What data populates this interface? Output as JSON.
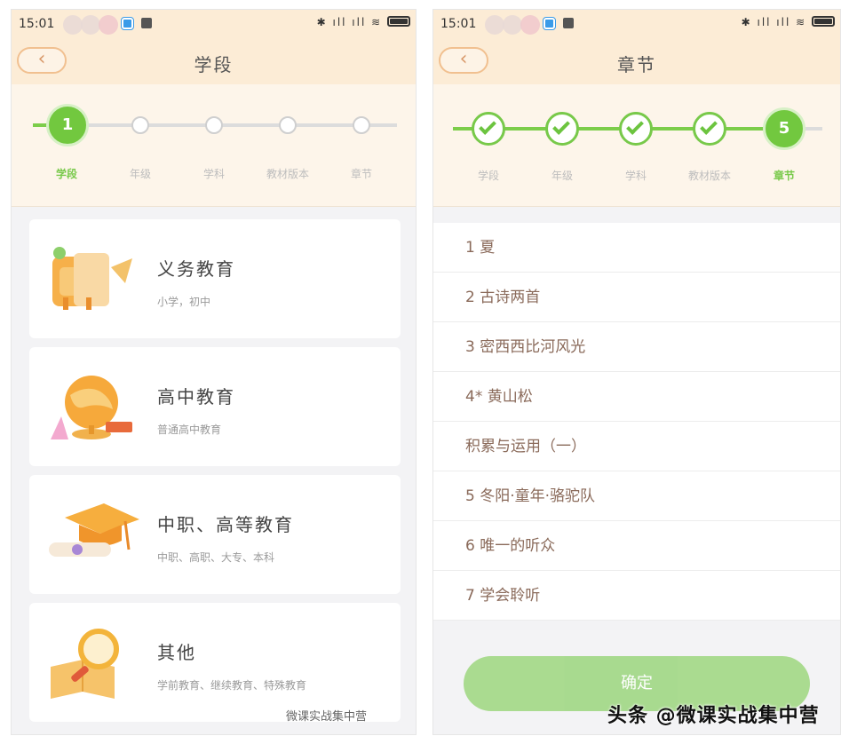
{
  "left_screen": {
    "status_time": "15:01",
    "title": "学段",
    "back_icon": "chevron-left-icon",
    "steps": [
      {
        "label": "学段",
        "number": "1",
        "state": "current"
      },
      {
        "label": "年级",
        "number": "",
        "state": "todo"
      },
      {
        "label": "学科",
        "number": "",
        "state": "todo"
      },
      {
        "label": "教材版本",
        "number": "",
        "state": "todo"
      },
      {
        "label": "章节",
        "number": "",
        "state": "todo"
      }
    ],
    "cards": [
      {
        "title": "义务教育",
        "subtitle": "小学，初中",
        "icon": "schoolbag-icon"
      },
      {
        "title": "高中教育",
        "subtitle": "普通高中教育",
        "icon": "globe-icon"
      },
      {
        "title": "中职、高等教育",
        "subtitle": "中职、高职、大专、本科",
        "icon": "graduation-cap-icon"
      },
      {
        "title": "其他",
        "subtitle": "学前教育、继续教育、特殊教育",
        "icon": "magnifier-book-icon"
      }
    ],
    "watermark": "微课实战集中营"
  },
  "right_screen": {
    "status_time": "15:01",
    "title": "章节",
    "back_icon": "chevron-left-icon",
    "steps": [
      {
        "label": "学段",
        "number": "",
        "state": "done"
      },
      {
        "label": "年级",
        "number": "",
        "state": "done"
      },
      {
        "label": "学科",
        "number": "",
        "state": "done"
      },
      {
        "label": "教材版本",
        "number": "",
        "state": "done"
      },
      {
        "label": "章节",
        "number": "5",
        "state": "current"
      }
    ],
    "chapters": [
      "1 夏",
      "2 古诗两首",
      "3 密西西比河风光",
      "4* 黄山松",
      "积累与运用（一）",
      "5 冬阳·童年·骆驼队",
      "6 唯一的听众",
      "7 学会聆听"
    ],
    "confirm_label": "确定",
    "accent_green": "#72c83f",
    "header_color": "#fcecd6"
  },
  "overlay_watermark": "头条 @微课实战集中营"
}
